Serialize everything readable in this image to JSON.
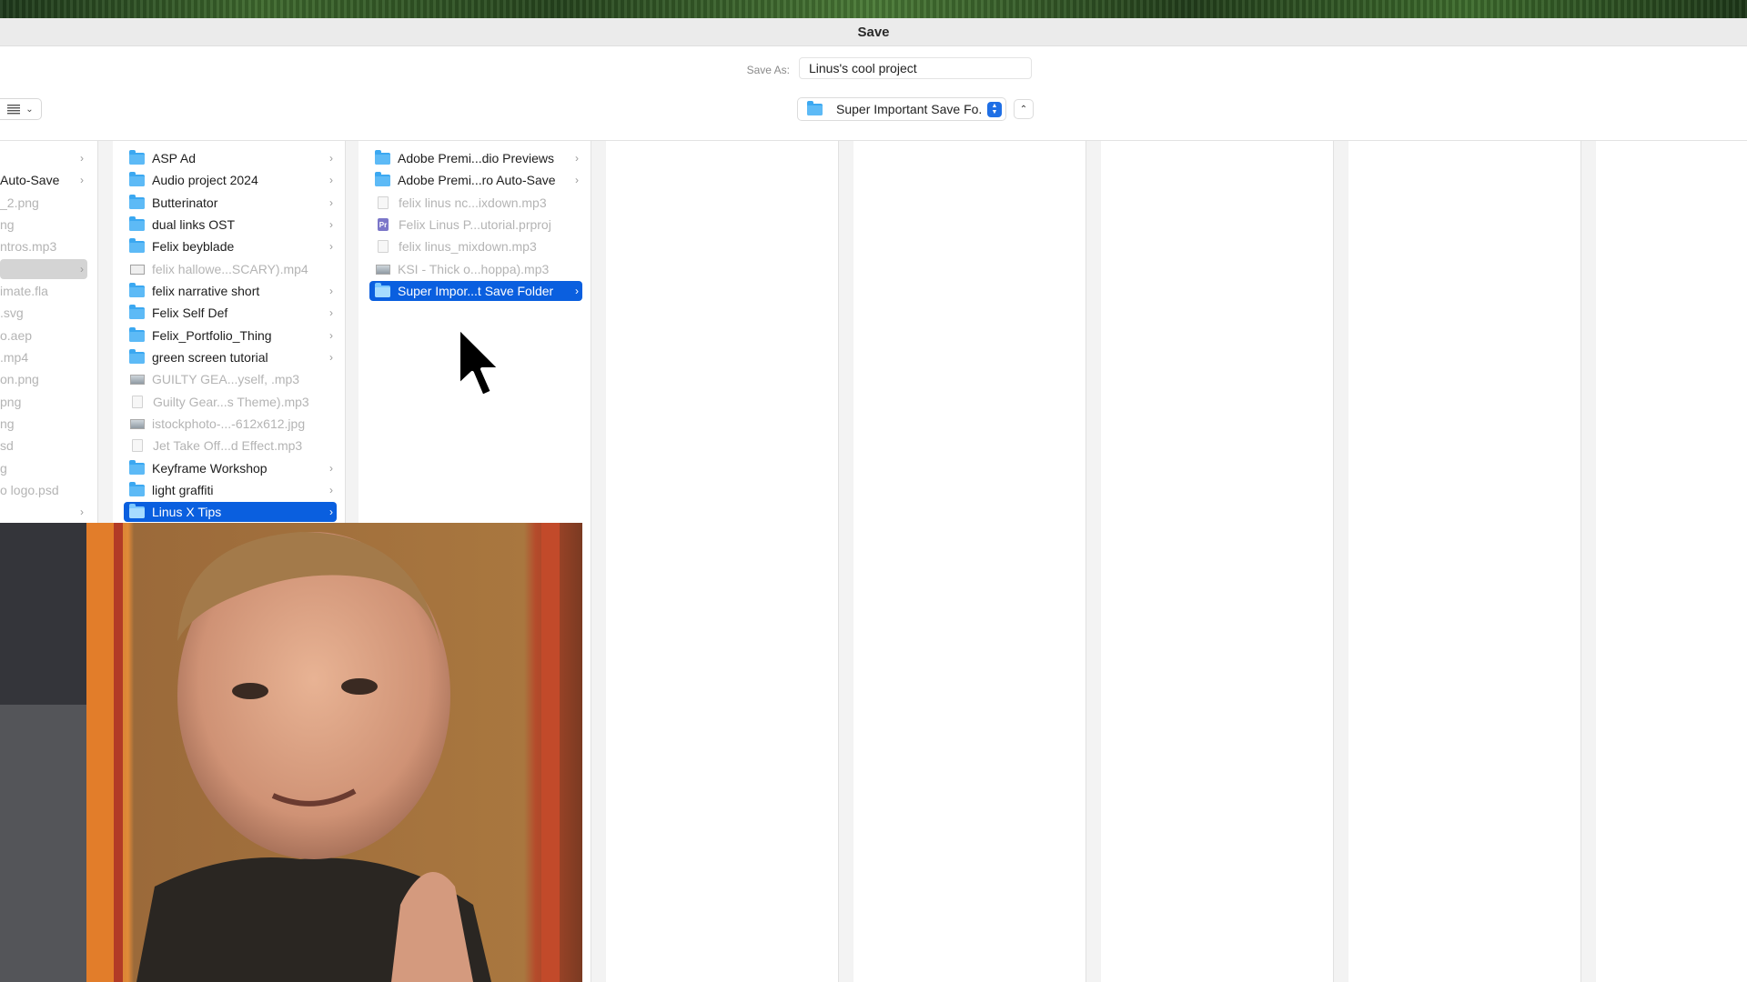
{
  "dialog": {
    "title": "Save",
    "save_as_label": "Save As:",
    "save_as_value": "Linus's cool project",
    "location": "Super Important Save Fo...",
    "accent_color": "#0a5fdf"
  },
  "columns": {
    "col1": [
      {
        "name": "",
        "kind": "folder-row"
      },
      {
        "name": "Auto-Save",
        "kind": "folder-row"
      },
      {
        "name": "_2.png",
        "kind": "file"
      },
      {
        "name": "ng",
        "kind": "file"
      },
      {
        "name": "ntros.mp3",
        "kind": "file"
      },
      {
        "name": "",
        "kind": "selected-parent"
      },
      {
        "name": "imate.fla",
        "kind": "file"
      },
      {
        "name": ".svg",
        "kind": "file"
      },
      {
        "name": "o.aep",
        "kind": "file"
      },
      {
        "name": ".mp4",
        "kind": "file"
      },
      {
        "name": "on.png",
        "kind": "file"
      },
      {
        "name": "png",
        "kind": "file"
      },
      {
        "name": "ng",
        "kind": "file"
      },
      {
        "name": "sd",
        "kind": "file"
      },
      {
        "name": "g",
        "kind": "file"
      },
      {
        "name": "o logo.psd",
        "kind": "file"
      },
      {
        "name": "",
        "kind": "folder-row"
      }
    ],
    "col2": [
      {
        "name": "ASP Ad",
        "kind": "folder"
      },
      {
        "name": "Audio project 2024",
        "kind": "folder"
      },
      {
        "name": "Butterinator",
        "kind": "folder"
      },
      {
        "name": "dual links OST",
        "kind": "folder"
      },
      {
        "name": "Felix beyblade",
        "kind": "folder"
      },
      {
        "name": "felix hallowe...SCARY).mp4",
        "kind": "video"
      },
      {
        "name": "felix narrative short",
        "kind": "folder"
      },
      {
        "name": "Felix Self Def",
        "kind": "folder"
      },
      {
        "name": "Felix_Portfolio_Thing",
        "kind": "folder"
      },
      {
        "name": "green screen tutorial",
        "kind": "folder"
      },
      {
        "name": "GUILTY GEA...yself, .mp3",
        "kind": "image"
      },
      {
        "name": "Guilty Gear...s Theme).mp3",
        "kind": "file"
      },
      {
        "name": "istockphoto-...-612x612.jpg",
        "kind": "image"
      },
      {
        "name": "Jet Take Off...d Effect.mp3",
        "kind": "file"
      },
      {
        "name": "Keyframe Workshop",
        "kind": "folder"
      },
      {
        "name": "light graffiti",
        "kind": "folder"
      },
      {
        "name": "Linus X Tips",
        "kind": "folder",
        "selected": true
      }
    ],
    "col3": [
      {
        "name": "Adobe Premi...dio Previews",
        "kind": "folder"
      },
      {
        "name": "Adobe Premi...ro Auto-Save",
        "kind": "folder"
      },
      {
        "name": "felix linus nc...ixdown.mp3",
        "kind": "file"
      },
      {
        "name": "Felix Linus P...utorial.prproj",
        "kind": "prproj"
      },
      {
        "name": "felix linus_mixdown.mp3",
        "kind": "file"
      },
      {
        "name": "KSI - Thick o...hoppa).mp3",
        "kind": "image"
      },
      {
        "name": "Super Impor...t Save Folder",
        "kind": "folder",
        "selected": true
      }
    ]
  }
}
